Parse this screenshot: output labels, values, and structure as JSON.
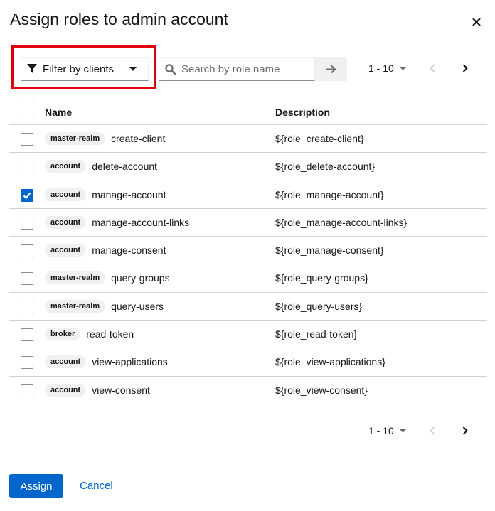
{
  "modal": {
    "title": "Assign roles to admin account",
    "close_icon": "close-icon"
  },
  "toolbar": {
    "filter_label": "Filter by clients",
    "filter_icon": "filter-icon",
    "search_placeholder": "Search by role name",
    "search_value": "",
    "search_icon": "search-icon",
    "go_icon": "arrow-right-icon",
    "highlight_color": "#e0000f"
  },
  "pagination": {
    "range_label": "1 - 10",
    "prev_icon": "chevron-left-icon",
    "next_icon": "chevron-right-icon"
  },
  "table": {
    "headers": {
      "name": "Name",
      "description": "Description"
    },
    "rows": [
      {
        "client": "master-realm",
        "role": "create-client",
        "description": "${role_create-client}",
        "checked": false
      },
      {
        "client": "account",
        "role": "delete-account",
        "description": "${role_delete-account}",
        "checked": false
      },
      {
        "client": "account",
        "role": "manage-account",
        "description": "${role_manage-account}",
        "checked": true
      },
      {
        "client": "account",
        "role": "manage-account-links",
        "description": "${role_manage-account-links}",
        "checked": false
      },
      {
        "client": "account",
        "role": "manage-consent",
        "description": "${role_manage-consent}",
        "checked": false
      },
      {
        "client": "master-realm",
        "role": "query-groups",
        "description": "${role_query-groups}",
        "checked": false
      },
      {
        "client": "master-realm",
        "role": "query-users",
        "description": "${role_query-users}",
        "checked": false
      },
      {
        "client": "broker",
        "role": "read-token",
        "description": "${role_read-token}",
        "checked": false
      },
      {
        "client": "account",
        "role": "view-applications",
        "description": "${role_view-applications}",
        "checked": false
      },
      {
        "client": "account",
        "role": "view-consent",
        "description": "${role_view-consent}",
        "checked": false
      }
    ]
  },
  "footer": {
    "assign_label": "Assign",
    "cancel_label": "Cancel"
  },
  "colors": {
    "primary": "#0066cc",
    "badge_bg": "#f0f0f0",
    "border": "#d2d2d2"
  }
}
